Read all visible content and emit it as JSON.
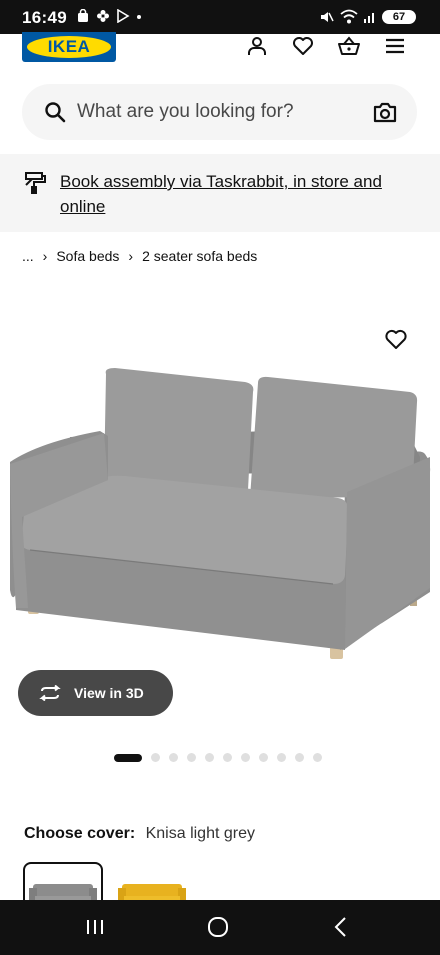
{
  "status_bar": {
    "time": "16:49",
    "battery": "67"
  },
  "header": {
    "logo_text": "IKEA",
    "icons": [
      "user-icon",
      "heart-icon",
      "basket-icon",
      "menu-icon"
    ]
  },
  "search": {
    "placeholder": "What are you looking for?"
  },
  "banner": {
    "link_text": "Book assembly via Taskrabbit, in store and online"
  },
  "breadcrumb": {
    "ellipsis": "...",
    "items": [
      "Sofa beds",
      "2 seater sofa beds"
    ]
  },
  "product": {
    "view_3d_label": "View in 3D",
    "image_count": 12,
    "active_image_index": 0
  },
  "cover": {
    "label": "Choose cover:",
    "selected": "Knisa light grey",
    "swatch_colors": [
      "#8c8c8c",
      "#e8b21f"
    ]
  },
  "colors": {
    "brand_blue": "#0058a3",
    "brand_yellow": "#ffdb00",
    "sofa_grey": "#9a9a9a"
  }
}
